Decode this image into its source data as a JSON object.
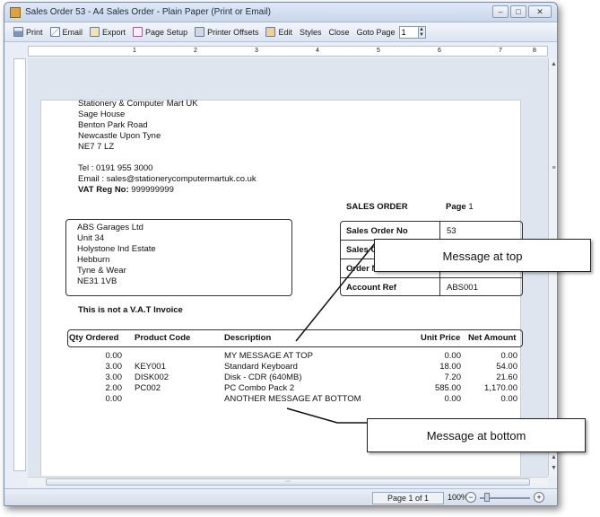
{
  "window": {
    "title": "Sales Order 53 - A4 Sales Order - Plain Paper (Print or Email)"
  },
  "toolbar": {
    "print": "Print",
    "email": "Email",
    "export": "Export",
    "page_setup": "Page Setup",
    "printer_offsets": "Printer Offsets",
    "edit": "Edit",
    "styles": "Styles",
    "close": "Close",
    "goto_page": "Goto Page",
    "goto_value": "1"
  },
  "ruler": {
    "marks": [
      "1",
      "2",
      "3",
      "4",
      "5",
      "6",
      "7",
      "8"
    ]
  },
  "document": {
    "company": {
      "name": "Stationery & Computer Mart UK",
      "address1": "Sage House",
      "address2": "Benton Park Road",
      "address3": "Newcastle Upon Tyne",
      "postcode": "NE7 7 LZ",
      "tel": "Tel : 0191 955 3000",
      "email": "Email : sales@stationerycomputermartuk.co.uk",
      "vat_label": "VAT Reg No:",
      "vat_value": " 999999999"
    },
    "customer": {
      "name": "ABS Garages Ltd",
      "line1": "Unit 34",
      "line2": "Holystone Ind Estate",
      "line3": "Hebburn",
      "line4": "Tyne & Wear",
      "postcode": "NE31 1VB"
    },
    "header": {
      "doc_type": "SALES ORDER",
      "page_label": "Page",
      "page_value": "1"
    },
    "info": [
      {
        "label": "Sales Order No",
        "value": "53"
      },
      {
        "label": "Sales O",
        "value": ""
      },
      {
        "label": "Order N",
        "value": ""
      },
      {
        "label": "Account Ref",
        "value": "ABS001"
      }
    ],
    "vat_note": "This is not a V.A.T Invoice",
    "table": {
      "columns": {
        "qty": "Qty Ordered",
        "code": "Product Code",
        "desc": "Description",
        "price": "Unit Price",
        "net": "Net Amount"
      },
      "rows": [
        {
          "qty": "0.00",
          "code": "",
          "desc": "MY MESSAGE AT TOP",
          "price": "0.00",
          "net": "0.00"
        },
        {
          "qty": "3.00",
          "code": "KEY001",
          "desc": "Standard Keyboard",
          "price": "18.00",
          "net": "54.00"
        },
        {
          "qty": "3.00",
          "code": "DISK002",
          "desc": "Disk - CDR (640MB)",
          "price": "7.20",
          "net": "21.60"
        },
        {
          "qty": "2.00",
          "code": "PC002",
          "desc": "PC Combo Pack 2",
          "price": "585.00",
          "net": "1,170.00"
        },
        {
          "qty": "0.00",
          "code": "",
          "desc": "ANOTHER MESSAGE AT BOTTOM",
          "price": "0.00",
          "net": "0.00"
        }
      ]
    }
  },
  "callouts": {
    "top": "Message at top",
    "bottom": "Message at bottom"
  },
  "status": {
    "page_indicator": "Page 1 of 1",
    "zoom": "100%"
  }
}
